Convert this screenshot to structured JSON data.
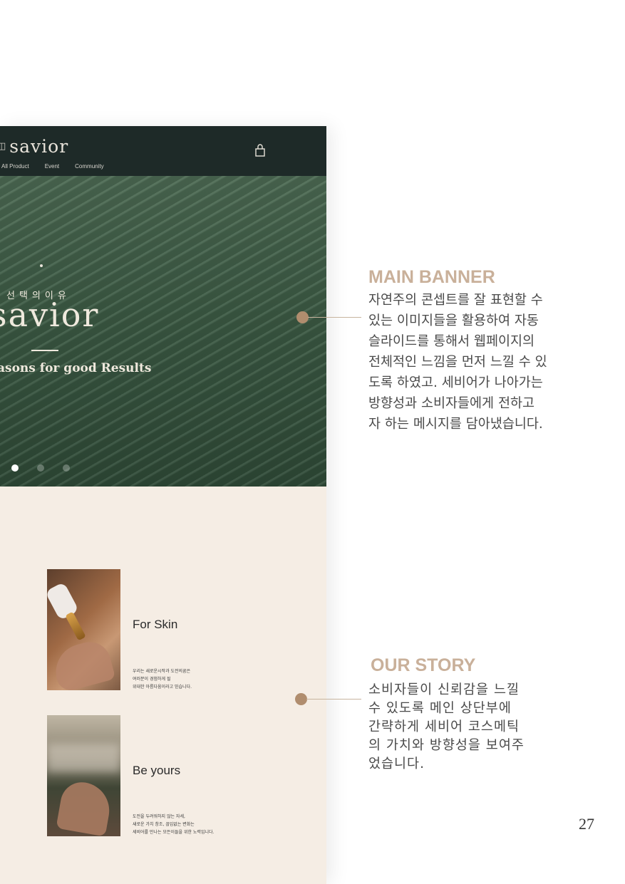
{
  "mockup": {
    "logo": "savior",
    "nav": [
      "All Product",
      "Event",
      "Community"
    ],
    "hero": {
      "subtitle": "선택의이유",
      "title": "savior",
      "tagline": "asons for good Results"
    },
    "story": {
      "items": [
        {
          "title": "For Skin",
          "desc": "우리는 새로운시작과 도전의꿈은\n여러분이 경험하게 될\n위대한 아름다움이라고 믿습니다."
        },
        {
          "title": "Be yours",
          "desc": "도전을 두려워하지 않는 자세,\n새로운 가치 창조, 끊임없는 변화는\n세비어를 만나는 모든이들을 위한 노력입니다."
        }
      ]
    }
  },
  "annotations": [
    {
      "title": "MAIN BANNER",
      "body": "자연주의 콘셉트를 잘 표현할 수\n있는 이미지들을 활용하여 자동\n슬라이드를 통해서 웹페이지의\n전체적인 느낌을 먼저 느낄 수 있\n도록 하였고. 세비어가 나아가는\n방향성과 소비자들에게 전하고\n자 하는 메시지를 담아냈습니다."
    },
    {
      "title": "OUR STORY",
      "body": "소비자들이 신뢰감을 느낄\n수 있도록 메인 상단부에\n간략하게 세비어 코스메틱\n의 가치와 방향성을 보여주\n었습니다."
    }
  ],
  "page_number": "27",
  "colors": {
    "header_bg": "#1e2a28",
    "hero_green": "#3c5a44",
    "story_bg": "#f5ede4",
    "annotation_title": "#c9b09a",
    "callout": "#b08d6e"
  }
}
